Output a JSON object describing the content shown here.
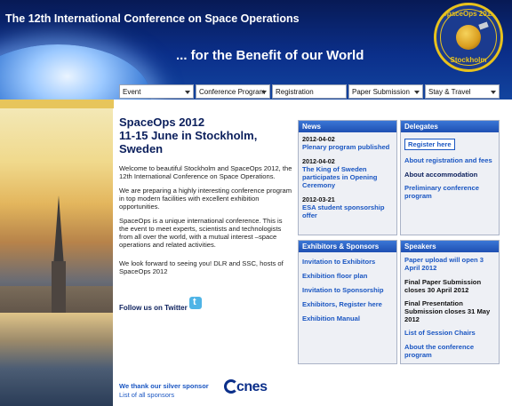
{
  "header": {
    "title": "The 12th International Conference on Space Operations",
    "tagline": "... for the Benefit of our World"
  },
  "logo": {
    "top_text": "SpaceOps 2012",
    "bottom_text": "Stockholm"
  },
  "nav": [
    {
      "label": "Event",
      "has_dropdown": true
    },
    {
      "label": "Conference Program",
      "has_dropdown": true
    },
    {
      "label": "Registration",
      "has_dropdown": false
    },
    {
      "label": "Paper Submission",
      "has_dropdown": true
    },
    {
      "label": "Stay & Travel",
      "has_dropdown": true
    }
  ],
  "intro": {
    "title": "SpaceOps 2012",
    "dates": "11-15 June in Stockholm, Sweden",
    "paragraphs": [
      "Welcome to beautiful Stockholm and SpaceOps 2012, the 12th International Conference on Space Operations.",
      "We are preparing a highly interesting conference program in top modern facilities with excellent exhibition opportunities.",
      "SpaceOps is a unique international conference. This is the event to meet experts, scientists and technologists from all over the world, with a mutual interest –space operations and related activities.",
      "We look forward to seeing you! DLR and SSC, hosts of SpaceOps 2012"
    ],
    "follow": "Follow us on Twitter",
    "thanks": "We thank our silver sponsor",
    "sponsor_list": "List of all sponsors",
    "sponsor_logo": "cnes"
  },
  "news": {
    "title": "News",
    "items": [
      {
        "date": "2012-04-02",
        "text": "Plenary program published"
      },
      {
        "date": "2012-04-02",
        "text": "The King of Sweden participates in Opening Ceremony"
      },
      {
        "date": "2012-03-21",
        "text": "ESA student sponsorship offer"
      }
    ]
  },
  "delegates": {
    "title": "Delegates",
    "register": "Register here",
    "links": [
      "About registration and fees",
      "About accommodation",
      "Preliminary conference program"
    ]
  },
  "exhibitors": {
    "title": "Exhibitors & Sponsors",
    "links": [
      "Invitation to Exhibitors",
      "Exhibition floor plan",
      "Invitation to Sponsorship",
      "Exhibitors, Register here",
      "Exhibition Manual"
    ]
  },
  "speakers": {
    "title": "Speakers",
    "upload": "Paper upload will open 3 April 2012",
    "final_paper": "Final Paper Submission closes 30 April 2012",
    "final_presentation": "Final Presentation Submission closes 31 May 2012",
    "links": [
      "List of Session Chairs",
      "About the conference program"
    ]
  }
}
